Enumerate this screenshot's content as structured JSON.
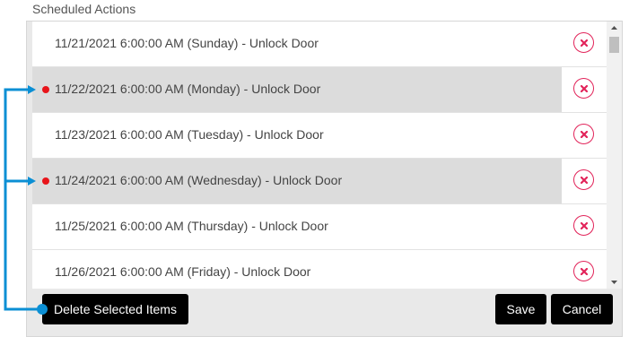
{
  "section": {
    "title": "Scheduled Actions"
  },
  "actions": [
    {
      "label": "11/21/2021 6:00:00 AM (Sunday) - Unlock Door",
      "selected": false
    },
    {
      "label": "11/22/2021 6:00:00 AM (Monday) - Unlock Door",
      "selected": true
    },
    {
      "label": "11/23/2021 6:00:00 AM (Tuesday) - Unlock Door",
      "selected": false
    },
    {
      "label": "11/24/2021 6:00:00 AM (Wednesday) - Unlock Door",
      "selected": true
    },
    {
      "label": "11/25/2021 6:00:00 AM (Thursday) - Unlock Door",
      "selected": false
    },
    {
      "label": "11/26/2021 6:00:00 AM (Friday) - Unlock Door",
      "selected": false
    }
  ],
  "row_delete_icon": "close-icon",
  "footer": {
    "delete_selected_label": "Delete Selected Items",
    "save_label": "Save",
    "cancel_label": "Cancel"
  },
  "colors": {
    "accent_annotation": "#0b8fd4",
    "delete_icon": "#e2245a",
    "selected_dot": "#e8151b",
    "selected_row": "#dcdcdc",
    "button_bg": "#000000"
  }
}
